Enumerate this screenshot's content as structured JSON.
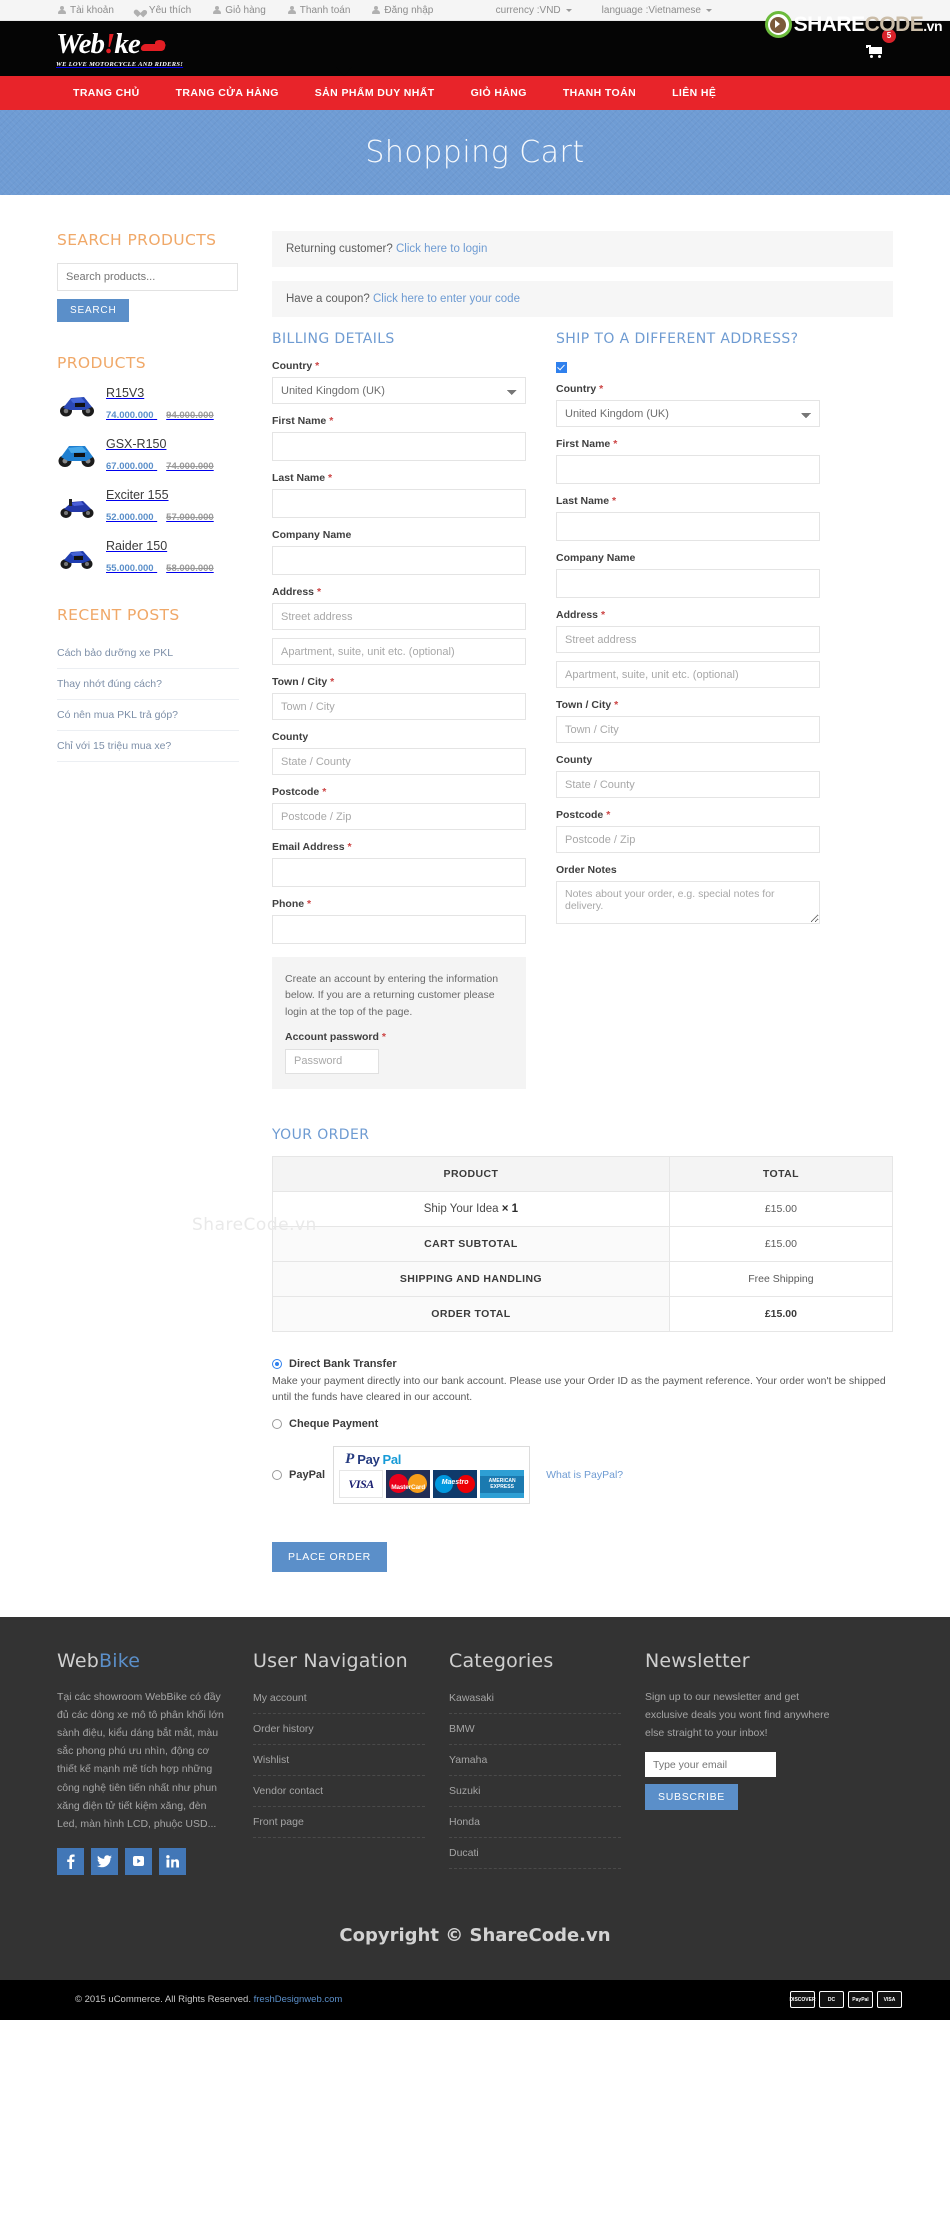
{
  "topbar": {
    "links": [
      {
        "label": "Tài khoản",
        "icon": "user-icon"
      },
      {
        "label": "Yêu thích",
        "icon": "heart-icon"
      },
      {
        "label": "Giỏ hàng",
        "icon": "user-icon"
      },
      {
        "label": "Thanh toán",
        "icon": "user-icon"
      },
      {
        "label": "Đăng nhập",
        "icon": "user-icon"
      }
    ],
    "currency": "currency :VND",
    "language": "language :Vietnamese"
  },
  "watermark": {
    "share": "SHARE",
    "code": "CODE",
    "vn": ".vn",
    "body": "ShareCode.vn"
  },
  "header": {
    "logo_text": "Web",
    "logo_bang": "!",
    "logo_text2": "ke",
    "logo_tagline": "WE LOVE MOTORCYCLE AND RIDERS!",
    "cart_count": "5"
  },
  "nav": {
    "items": [
      {
        "label": "TRANG CHỦ"
      },
      {
        "label": "TRANG CỬA HÀNG"
      },
      {
        "label": "SẢN PHẨM DUY NHẤT"
      },
      {
        "label": "GIỎ HÀNG"
      },
      {
        "label": "THANH TOÁN"
      },
      {
        "label": "LIÊN HỆ"
      }
    ]
  },
  "hero": {
    "title": "Shopping Cart"
  },
  "sidebar": {
    "search_title": "SEARCH PRODUCTS",
    "search_placeholder": "Search products...",
    "search_button": "SEARCH",
    "products_title": "PRODUCTS",
    "products": [
      {
        "name": "R15V3",
        "price": "74.000.000",
        "old_price": "94.000.000"
      },
      {
        "name": "GSX-R150",
        "price": "67.000.000",
        "old_price": "74.000.000"
      },
      {
        "name": "Exciter 155",
        "price": "52.000.000",
        "old_price": "57.000.000"
      },
      {
        "name": "Raider 150",
        "price": "55.000.000",
        "old_price": "58.000.000"
      }
    ],
    "posts_title": "RECENT POSTS",
    "posts": [
      {
        "label": "Cách bảo dưỡng xe PKL"
      },
      {
        "label": "Thay nhớt đúng cách?"
      },
      {
        "label": "Có nên mua PKL trả góp?"
      },
      {
        "label": "Chỉ với 15 triệu mua xe?"
      }
    ]
  },
  "checkout": {
    "returning_prefix": "Returning customer? ",
    "returning_link": "Click here to login",
    "coupon_prefix": "Have a coupon? ",
    "coupon_link": "Click here to enter your code",
    "billing_title": "BILLING DETAILS",
    "shipping_title": "SHIP TO A DIFFERENT ADDRESS?",
    "labels": {
      "country": "Country",
      "first_name": "First Name",
      "last_name": "Last Name",
      "company": "Company Name",
      "address": "Address",
      "town": "Town / City",
      "county": "County",
      "postcode": "Postcode",
      "email": "Email Address",
      "phone": "Phone",
      "order_notes": "Order Notes",
      "account_password": "Account password"
    },
    "country_value": "United Kingdom (UK)",
    "placeholders": {
      "street": "Street address",
      "apartment": "Apartment, suite, unit etc. (optional)",
      "town": "Town / City",
      "county": "State / County",
      "postcode": "Postcode / Zip",
      "order_notes": "Notes about your order, e.g. special notes for delivery.",
      "password": "Password"
    },
    "account_text": "Create an account by entering the information below. If you are a returning customer please login at the top of the page."
  },
  "order": {
    "title": "YOUR ORDER",
    "headers": [
      "PRODUCT",
      "TOTAL"
    ],
    "rows": [
      {
        "label": "Ship Your Idea",
        "qty": "× 1",
        "value": "£15.00",
        "type": "item"
      },
      {
        "label": "CART SUBTOTAL",
        "value": "£15.00",
        "type": "sum"
      },
      {
        "label": "SHIPPING AND HANDLING",
        "value": "Free Shipping",
        "type": "sum"
      },
      {
        "label": "ORDER TOTAL",
        "value": "£15.00",
        "type": "total"
      }
    ]
  },
  "payment": {
    "bank_label": "Direct Bank Transfer",
    "bank_desc": "Make your payment directly into our bank account. Please use your Order ID as the payment reference. Your order won't be shipped until the funds have cleared in our account.",
    "cheque_label": "Cheque Payment",
    "paypal_label": "PayPal",
    "paypal_brand_p": "Pay",
    "paypal_brand_pal": "Pal",
    "cards": [
      "VISA",
      "MasterCard",
      "Maestro",
      "AMERICAN EXPRESS"
    ],
    "what_is_paypal": "What is PayPal?",
    "place_order": "PLACE ORDER"
  },
  "footer": {
    "brand_web": "Web",
    "brand_bike": "Bike",
    "about_text": "Tại các showroom WebBike có đầy đủ các dòng xe mô tô phân khối lớn sành điệu, kiểu dáng bắt mắt, màu sắc phong phú ưu nhìn, động cơ thiết kế mạnh mẽ tích hợp những công nghệ tiên tiến nhất như phun xăng điện tử tiết kiệm xăng, đèn Led, màn hình LCD, phuộc USD...",
    "socials": [
      "facebook-icon",
      "twitter-icon",
      "youtube-icon",
      "linkedin-icon"
    ],
    "nav_title": "User Navigation",
    "nav_links": [
      {
        "label": "My account"
      },
      {
        "label": "Order history"
      },
      {
        "label": "Wishlist"
      },
      {
        "label": "Vendor contact"
      },
      {
        "label": "Front page"
      }
    ],
    "cat_title": "Categories",
    "cat_links": [
      {
        "label": "Kawasaki"
      },
      {
        "label": "BMW"
      },
      {
        "label": "Yamaha"
      },
      {
        "label": "Suzuki"
      },
      {
        "label": "Honda"
      },
      {
        "label": "Ducati"
      }
    ],
    "news_title": "Newsletter",
    "news_text": "Sign up to our newsletter and get exclusive deals you wont find anywhere else straight to your inbox!",
    "news_placeholder": "Type your email",
    "news_button": "SUBSCRIBE",
    "copyright_big": "Copyright © ShareCode.vn",
    "bottom_text": "© 2015 uCommerce. All Rights Reserved. ",
    "bottom_link": "freshDesignweb.com",
    "pay_chips": [
      "DISCOVER",
      "DC",
      "PayPal",
      "VISA"
    ]
  },
  "colors": {
    "brand_red": "#e8242a",
    "accent_blue": "#5b8fc9",
    "hero_blue": "#6e9bd2",
    "orange_title": "#f0a868"
  }
}
